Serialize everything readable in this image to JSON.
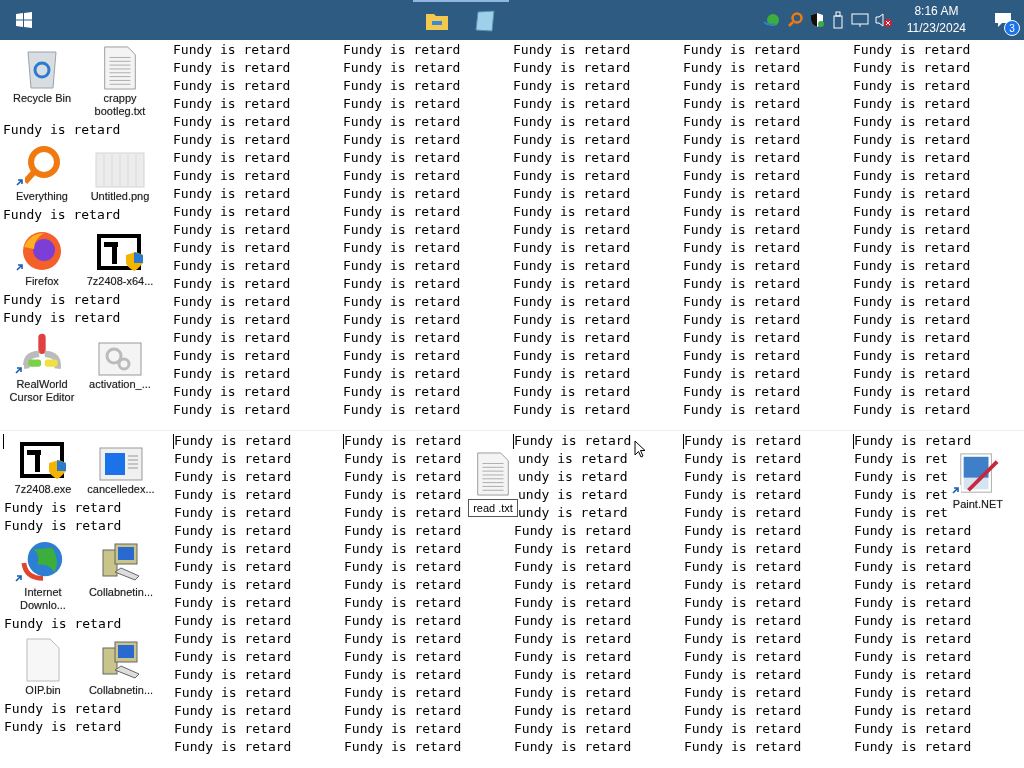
{
  "taskbar": {
    "apps": [
      {
        "kind": "folder",
        "running": true
      },
      {
        "kind": "notepad",
        "running": true
      }
    ],
    "clock": {
      "time": "8:16 AM",
      "date": "11/23/2024"
    },
    "notifications": {
      "count": "3"
    }
  },
  "desktop": {
    "panes": [
      {
        "caret": false,
        "columns": [
          {
            "blocks": [
              {
                "kind": "icons",
                "icons": [
                  {
                    "label": "Recycle Bin",
                    "kind": "recycle-bin",
                    "shortcut": false,
                    "editing": false
                  },
                  {
                    "label": "crappy bootleg.txt",
                    "kind": "text-file",
                    "shortcut": false,
                    "editing": false
                  }
                ]
              },
              {
                "kind": "text",
                "text": "Fundy is retard"
              },
              {
                "kind": "icons",
                "icons": [
                  {
                    "label": "Everything",
                    "kind": "search-app",
                    "shortcut": true,
                    "editing": false
                  },
                  {
                    "label": "Untitled.png",
                    "kind": "image-file",
                    "shortcut": false,
                    "editing": false
                  }
                ]
              },
              {
                "kind": "text",
                "text": "Fundy is retard"
              },
              {
                "kind": "icons",
                "icons": [
                  {
                    "label": "Firefox",
                    "kind": "browser",
                    "shortcut": true,
                    "editing": false
                  },
                  {
                    "label": "7z2408-x64...",
                    "kind": "installer",
                    "shortcut": false,
                    "editing": false
                  }
                ]
              },
              {
                "kind": "text",
                "text": "Fundy is retard\nFundy is retard"
              },
              {
                "kind": "icons",
                "icons": [
                  {
                    "label": "RealWorld Cursor Editor",
                    "kind": "cursor-app",
                    "shortcut": true,
                    "editing": false
                  },
                  {
                    "label": "activation_...",
                    "kind": "settings-window",
                    "shortcut": false,
                    "editing": false
                  }
                ]
              }
            ]
          },
          {
            "blocks": [
              {
                "kind": "text",
                "text": "Fundy is retard\nFundy is retard\nFundy is retard\nFundy is retard\nFundy is retard\nFundy is retard\nFundy is retard\nFundy is retard\nFundy is retard\nFundy is retard\nFundy is retard\nFundy is retard\nFundy is retard\nFundy is retard\nFundy is retard\nFundy is retard\nFundy is retard\nFundy is retard\nFundy is retard\nFundy is retard\nFundy is retard"
              }
            ]
          },
          {
            "blocks": [
              {
                "kind": "text",
                "text": "Fundy is retard\nFundy is retard\nFundy is retard\nFundy is retard\nFundy is retard\nFundy is retard\nFundy is retard\nFundy is retard\nFundy is retard\nFundy is retard\nFundy is retard\nFundy is retard\nFundy is retard\nFundy is retard\nFundy is retard\nFundy is retard\nFundy is retard\nFundy is retard\nFundy is retard\nFundy is retard\nFundy is retard"
              }
            ]
          },
          {
            "blocks": [
              {
                "kind": "text",
                "text": "Fundy is retard\nFundy is retard\nFundy is retard\nFundy is retard\nFundy is retard\nFundy is retard\nFundy is retard\nFundy is retard\nFundy is retard\nFundy is retard\nFundy is retard\nFundy is retard\nFundy is retard\nFundy is retard\nFundy is retard\nFundy is retard\nFundy is retard\nFundy is retard\nFundy is retard\nFundy is retard\nFundy is retard"
              }
            ]
          },
          {
            "blocks": [
              {
                "kind": "text",
                "text": "Fundy is retard\nFundy is retard\nFundy is retard\nFundy is retard\nFundy is retard\nFundy is retard\nFundy is retard\nFundy is retard\nFundy is retard\nFundy is retard\nFundy is retard\nFundy is retard\nFundy is retard\nFundy is retard\nFundy is retard\nFundy is retard\nFundy is retard\nFundy is retard\nFundy is retard\nFundy is retard\nFundy is retard"
              }
            ]
          },
          {
            "blocks": [
              {
                "kind": "text",
                "text": "Fundy is retard\nFundy is retard\nFundy is retard\nFundy is retard\nFundy is retard\nFundy is retard\nFundy is retard\nFundy is retard\nFundy is retard\nFundy is retard\nFundy is retard\nFundy is retard\nFundy is retard\nFundy is retard\nFundy is retard\nFundy is retard\nFundy is retard\nFundy is retard\nFundy is retard\nFundy is retard\nFundy is retard"
              }
            ]
          }
        ]
      },
      {
        "caret": true,
        "columns": [
          {
            "blocks": [
              {
                "kind": "icons",
                "icons": [
                  {
                    "label": "7z2408.exe",
                    "kind": "installer",
                    "shortcut": false,
                    "editing": false
                  },
                  {
                    "label": "cancelledex...",
                    "kind": "app-window",
                    "shortcut": false,
                    "editing": false
                  }
                ]
              },
              {
                "kind": "text",
                "text": "Fundy is retard\nFundy is retard"
              },
              {
                "kind": "icons",
                "icons": [
                  {
                    "label": "Internet Downlo...",
                    "kind": "globe",
                    "shortcut": true,
                    "editing": false
                  },
                  {
                    "label": "Collabnetin...",
                    "kind": "network",
                    "shortcut": false,
                    "editing": false
                  }
                ]
              },
              {
                "kind": "text",
                "text": "Fundy is retard"
              },
              {
                "kind": "icons",
                "icons": [
                  {
                    "label": "OIP.bin",
                    "kind": "blank-file",
                    "shortcut": false,
                    "editing": false
                  },
                  {
                    "label": "Collabnetin...",
                    "kind": "network",
                    "shortcut": false,
                    "editing": false
                  }
                ]
              },
              {
                "kind": "text",
                "text": "Fundy is retard\nFundy is retard"
              }
            ]
          },
          {
            "blocks": [
              {
                "kind": "text",
                "text": "Fundy is retard\nFundy is retard\nFundy is retard\nFundy is retard\nFundy is retard\nFundy is retard\nFundy is retard\nFundy is retard\nFundy is retard\nFundy is retard\nFundy is retard\nFundy is retard\nFundy is retard\nFundy is retard\nFundy is retard\nFundy is retard\nFundy is retard\nFundy is retard"
              }
            ]
          },
          {
            "blocks": [
              {
                "kind": "text",
                "text": "Fundy is retard\nFundy is retard\nFundy is retard\nFundy is retard\nFundy is retard\nFundy is retard\nFundy is retard\nFundy is retard\nFundy is retard\nFundy is retard\nFundy is retard\nFundy is retard\nFundy is retard\nFundy is retard\nFundy is retard\nFundy is retard\nFundy is retard\nFundy is retard"
              }
            ]
          },
          {
            "blocks": [
              {
                "kind": "text",
                "text": "Fundy is retard"
              },
              {
                "kind": "icons",
                "text_after": "undy is retard\nundy is retard\nundy is retard\nundy is retard",
                "icons": [
                  {
                    "label": "read .txt",
                    "kind": "text-file",
                    "shortcut": false,
                    "editing": true
                  }
                ]
              },
              {
                "kind": "text",
                "text": "Fundy is retard\nFundy is retard\nFundy is retard\nFundy is retard\nFundy is retard\nFundy is retard\nFundy is retard\nFundy is retard\nFundy is retard\nFundy is retard\nFundy is retard\nFundy is retard\nFundy is retard"
              }
            ]
          },
          {
            "blocks": [
              {
                "kind": "text",
                "text": "Fundy is retard\nFundy is retard\nFundy is retard\nFundy is retard\nFundy is retard\nFundy is retard\nFundy is retard\nFundy is retard\nFundy is retard\nFundy is retard\nFundy is retard\nFundy is retard\nFundy is retard\nFundy is retard\nFundy is retard\nFundy is retard\nFundy is retard\nFundy is retard"
              }
            ]
          },
          {
            "blocks": [
              {
                "kind": "text",
                "text": "Fundy is retard"
              },
              {
                "kind": "icons",
                "text_before": "Fundy is ret\nFundy is ret\nFundy is ret\nFundy is ret",
                "icons": [
                  {
                    "label": "Paint.NET",
                    "kind": "paint",
                    "shortcut": true,
                    "editing": false
                  }
                ]
              },
              {
                "kind": "text",
                "text": "Fundy is retard\nFundy is retard\nFundy is retard\nFundy is retard\nFundy is retard\nFundy is retard\nFundy is retard\nFundy is retard\nFundy is retard\nFundy is retard\nFundy is retard\nFundy is retard\nFundy is retard"
              }
            ]
          }
        ]
      }
    ]
  }
}
